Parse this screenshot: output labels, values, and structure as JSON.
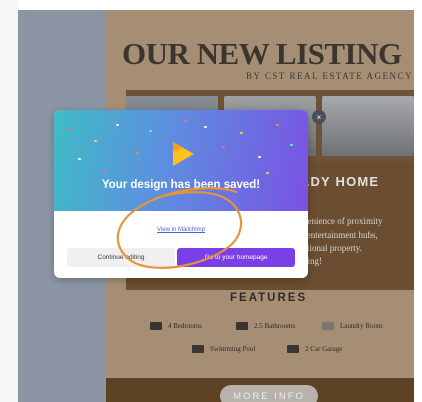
{
  "background_canvas": {
    "heading": "OUR NEW LISTING",
    "subheading": "BY CST REAL ESTATE AGENCY",
    "ready_text": "EADY HOME",
    "paragraph_lines": [
      "convenience of proximity",
      "ront entertainment hubs,",
      "xceptional property.",
      "viewing!"
    ],
    "features_title": "FEATURES",
    "features": [
      {
        "label": "4 Bedrooms",
        "icon": "bed-icon"
      },
      {
        "label": "2.5 Bathrooms",
        "icon": "bathtub-icon"
      },
      {
        "label": "Laundry Room",
        "icon": "laundry-icon"
      },
      {
        "label": "Swimming Pool",
        "icon": "pool-icon"
      },
      {
        "label": "2 Car Garage",
        "icon": "car-icon"
      }
    ],
    "cta_button": "MORE INFO"
  },
  "modal": {
    "title": "Your design has been saved!",
    "link_text": "View in Mailchimp",
    "secondary_button": "Continue editing",
    "primary_button": "Go to your homepage",
    "close_icon": "close-icon",
    "hero_icon": "play-icon"
  },
  "colors": {
    "primary_button": "#7b3fe8",
    "hero_gradient_start": "#3fbcc6",
    "hero_gradient_end": "#7a52e3",
    "annotation_orange": "#e5943a",
    "canvas_brown": "#6b4e31"
  }
}
